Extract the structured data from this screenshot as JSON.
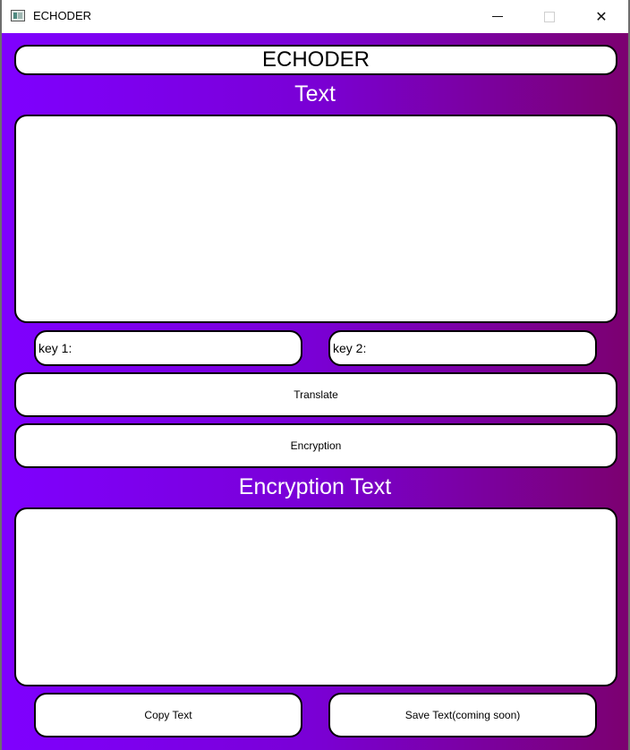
{
  "window": {
    "title": "ECHODER",
    "minimize_glyph": "",
    "close_glyph": "✕"
  },
  "app": {
    "header": "ECHODER",
    "input_label": "Text",
    "input_value": "",
    "key1_label": "key 1:",
    "key1_value": "",
    "key2_label": "key 2:",
    "key2_value": "",
    "translate_label": "Translate",
    "encrypt_label": "Encryption",
    "output_label": "Encryption Text",
    "output_value": "",
    "copy_label": "Copy Text",
    "save_label": "Save Text(coming soon)"
  },
  "colors": {
    "gradient_start": "#7f00ff",
    "gradient_end": "#7c0070",
    "field_bg": "#ffffff",
    "label_text": "#ffffff"
  },
  "icons": {
    "app": "app-window-icon",
    "minimize": "minimize-icon",
    "maximize": "maximize-icon",
    "close": "close-icon"
  }
}
